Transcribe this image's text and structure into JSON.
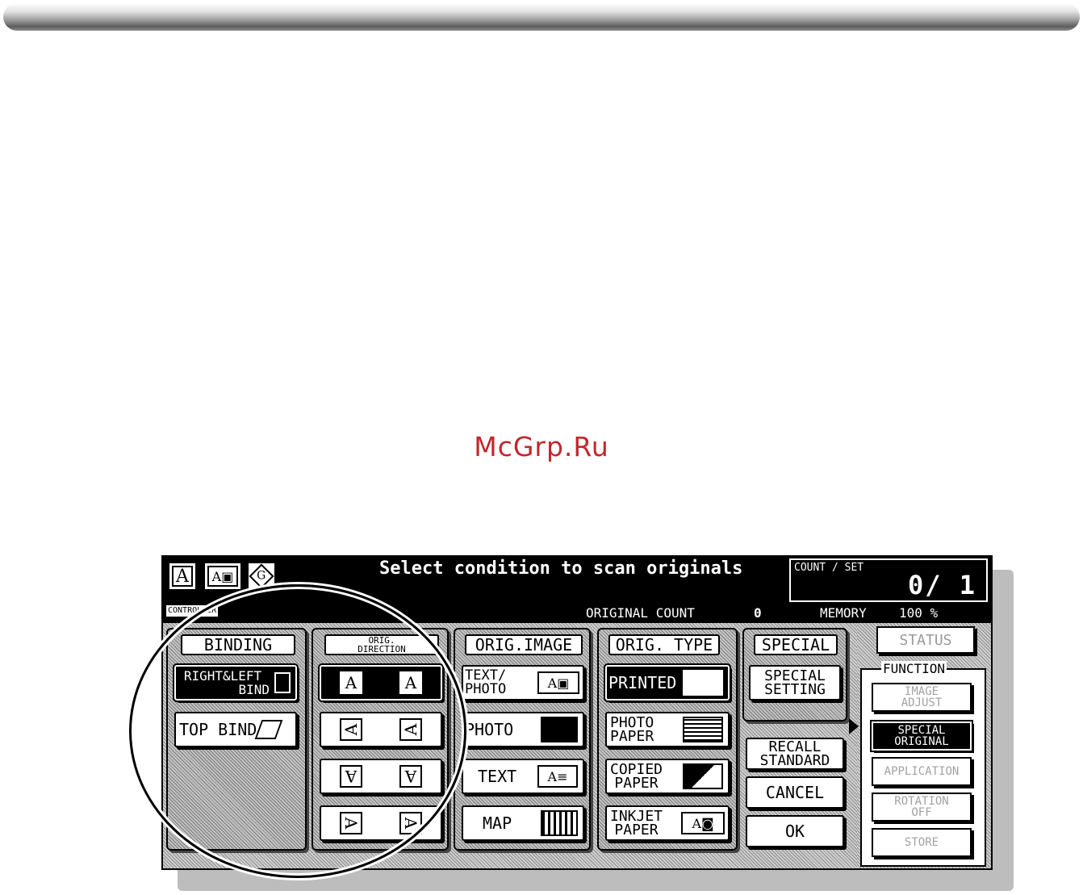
{
  "header": {
    "title": "Select condition to scan originals",
    "count_label": "COUNT / SET",
    "count_value": "0/ 1",
    "controller": "CONTROLLER",
    "original_count_label": "ORIGINAL COUNT",
    "original_count_value": "0",
    "memory_label": "MEMORY",
    "memory_value": "100 %",
    "mode_icons": [
      {
        "icon": "text-mode-icon",
        "glyph": "A"
      },
      {
        "icon": "text-photo-mode-icon",
        "glyph": "A▣"
      },
      {
        "icon": "auto-rotate-icon",
        "glyph": "G"
      }
    ]
  },
  "watermark": "McGrp.Ru",
  "binding": {
    "tab": "BINDING",
    "right_left_bind_line1": "RIGHT&LEFT",
    "right_left_bind_line2": "BIND",
    "top_bind": "TOP BIND"
  },
  "direction": {
    "tab_line1": "ORIG.",
    "tab_line2": "DIRECTION",
    "glyph": "A"
  },
  "orig_image": {
    "tab": "ORIG.IMAGE",
    "text_photo_line1": "TEXT/",
    "text_photo_line2": "PHOTO",
    "photo": "PHOTO",
    "text": "TEXT",
    "map": "MAP",
    "glyph": "A"
  },
  "orig_type": {
    "tab": "ORIG. TYPE",
    "printed": "PRINTED",
    "photo_paper_line1": "PHOTO",
    "photo_paper_line2": "PAPER",
    "copied_paper_line1": "COPIED",
    "copied_paper_line2": "PAPER",
    "inkjet_paper_line1": "INKJET",
    "inkjet_paper_line2": "PAPER",
    "glyph": "A"
  },
  "special": {
    "tab": "SPECIAL",
    "setting_line1": "SPECIAL",
    "setting_line2": "SETTING",
    "recall_line1": "RECALL",
    "recall_line2": "STANDARD",
    "cancel": "CANCEL",
    "ok": "OK"
  },
  "function": {
    "status": "STATUS",
    "title": "FUNCTION",
    "image_adjust_line1": "IMAGE",
    "image_adjust_line2": "ADJUST",
    "special_original_line1": "SPECIAL",
    "special_original_line2": "ORIGINAL",
    "application": "APPLICATION",
    "rotation_off_line1": "ROTATION",
    "rotation_off_line2": "OFF",
    "store": "STORE"
  }
}
